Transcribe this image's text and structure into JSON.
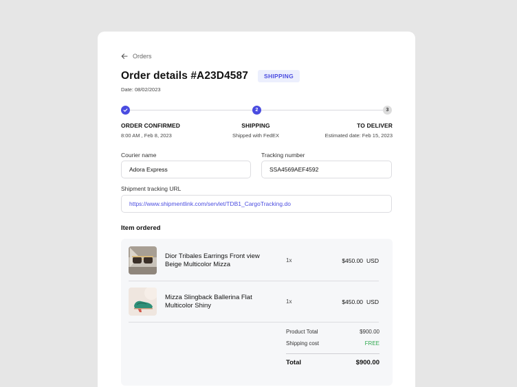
{
  "breadcrumb": {
    "label": "Orders"
  },
  "order": {
    "title": "Order details #A23D4587",
    "status_badge": "SHIPPING",
    "date": "Date: 08/02/2023"
  },
  "progress": {
    "steps": [
      {
        "number": "✓",
        "title": "ORDER CONFIRMED",
        "subtitle": "8:00 AM , Feb 8, 2023",
        "state": "done"
      },
      {
        "number": "2",
        "title": "SHIPPING",
        "subtitle": "Shipped with FedEX",
        "state": "active"
      },
      {
        "number": "3",
        "title": "TO DELIVER",
        "subtitle": "Estimated date: Feb 15, 2023",
        "state": "pending"
      }
    ]
  },
  "shipment": {
    "courier_label": "Courier name",
    "courier_value": "Adora Express",
    "tracking_label": "Tracking number",
    "tracking_value": "SSA4569AEF4592",
    "url_label": "Shipment tracking URL",
    "url_value": "https://www.shipmentlink.com/servlet/TDB1_CargoTracking.do"
  },
  "items_section": {
    "title": "Item ordered",
    "items": [
      {
        "name": "Dior Tribales Earrings Front view Beige Multicolor Mizza",
        "qty": "1x",
        "price": "$450.00",
        "currency": "USD",
        "thumb_icon": "sunglasses-product-image"
      },
      {
        "name": "Mizza Slingback Ballerina Flat Multicolor  Shiny",
        "qty": "1x",
        "price": "$450.00",
        "currency": "USD",
        "thumb_icon": "shoe-product-image"
      }
    ],
    "summary": {
      "product_total_label": "Product Total",
      "product_total_value": "$900.00",
      "shipping_label": "Shipping cost",
      "shipping_value": "FREE",
      "total_label": "Total",
      "total_value": "$900.00"
    }
  },
  "colors": {
    "accent": "#4a4ce0",
    "success": "#2fa84f",
    "background": "#e6e6e6"
  }
}
